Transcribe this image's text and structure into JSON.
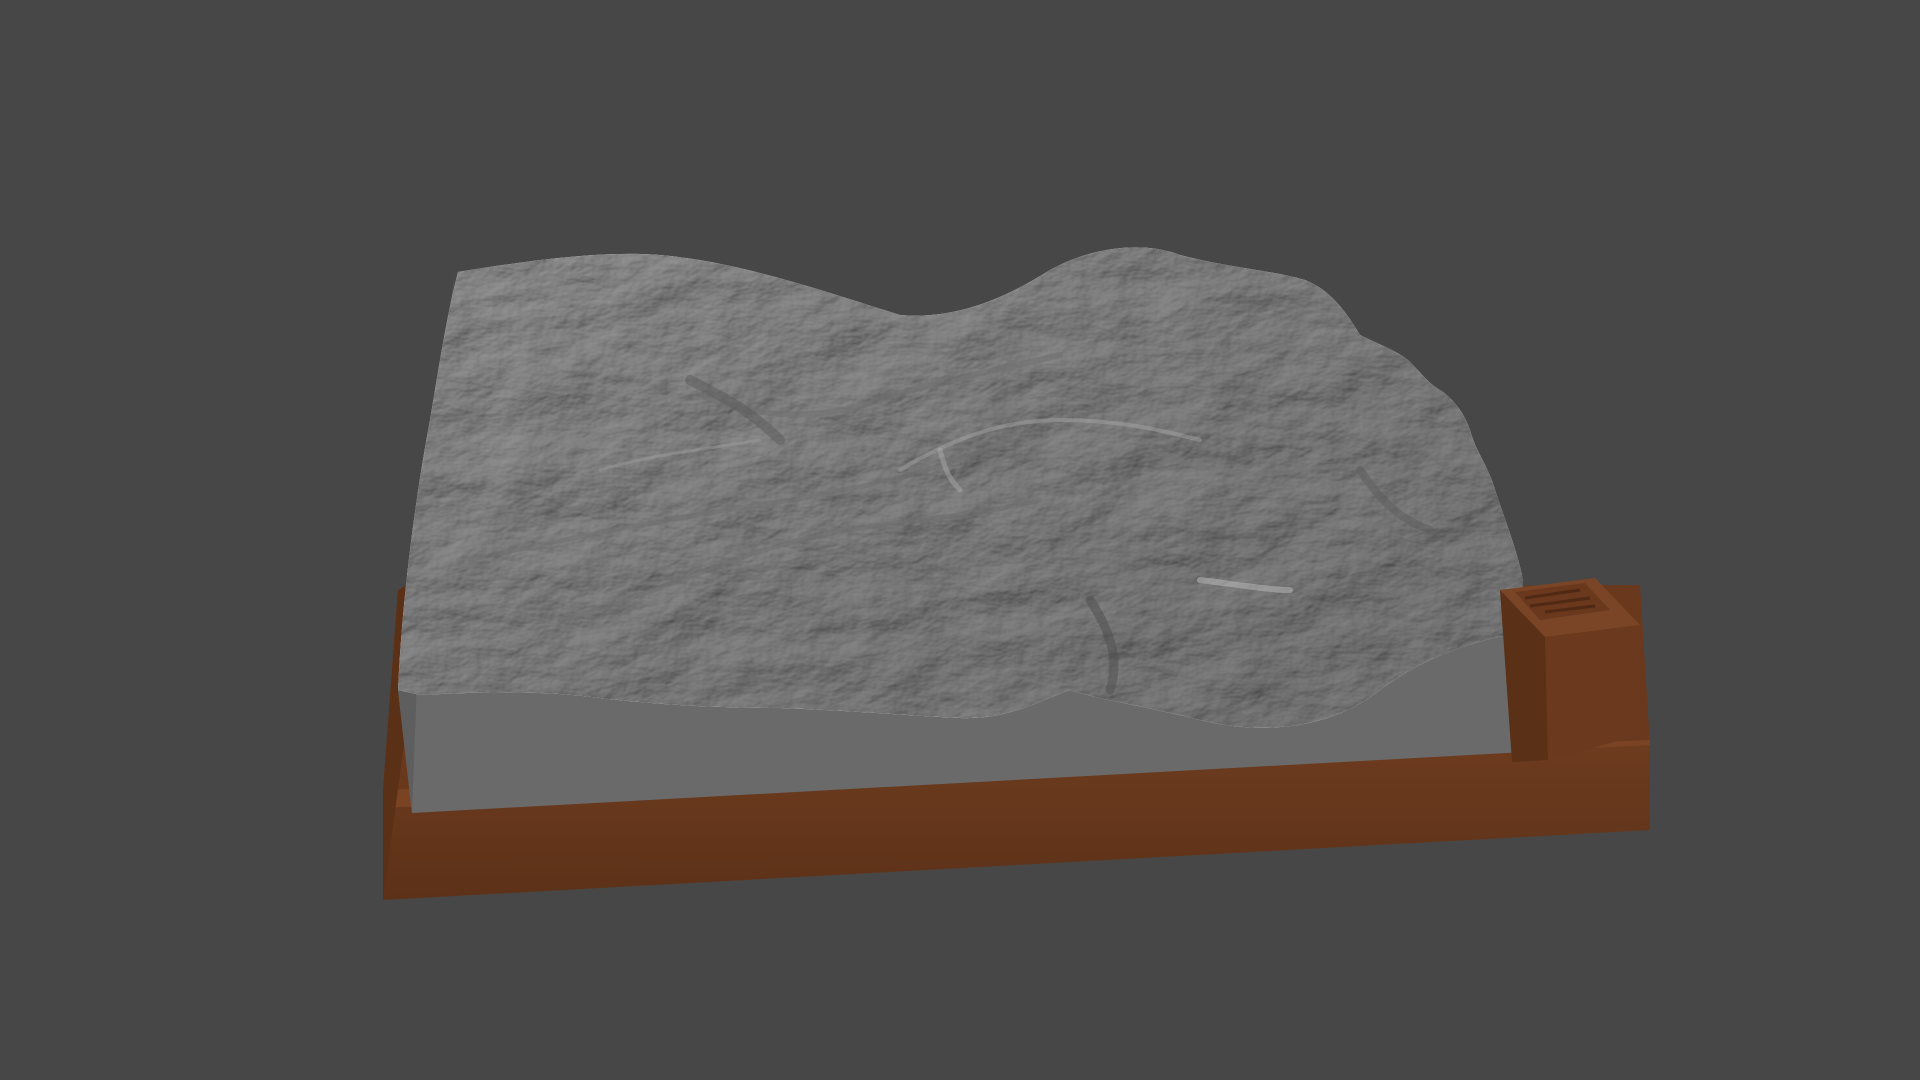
{
  "scene": {
    "background_color": "#474747",
    "terrain_color": "#8e8e8e",
    "terrain_side_color": "#6b6b6b",
    "base_color": "#6b3a1e",
    "subject": "3d-printable-terrain-relief-model",
    "label_block_icon": "engraved-plaque-icon"
  }
}
